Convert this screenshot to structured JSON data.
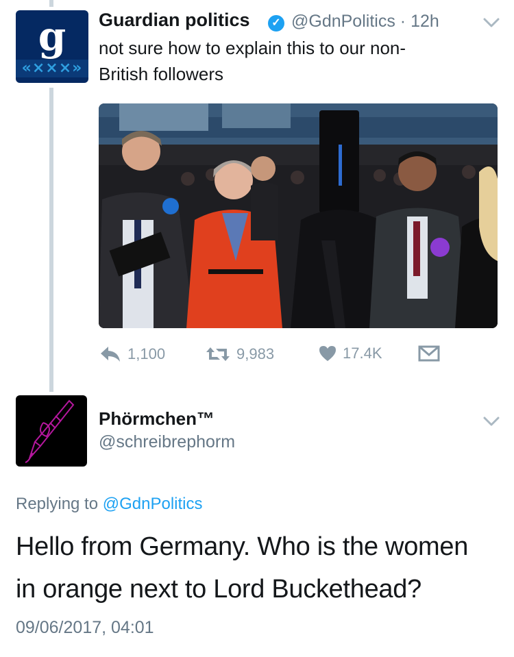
{
  "tweet": {
    "author_name": "Guardian politics",
    "author_handle": "@GdnPolitics",
    "separator": "·",
    "time": "12h",
    "avatar_letter": "g",
    "avatar_pattern": "«×××»",
    "text_line1": "not sure how to explain this to our non-",
    "text_line2": "British followers",
    "photo_alt": "photo",
    "actions": {
      "reply_count": "1,100",
      "retweet_count": "9,983",
      "like_count": "17.4K"
    }
  },
  "reply": {
    "author_name": "Phörmchen™",
    "author_handle": "@schreibrephorm",
    "replying_prefix": "Replying to",
    "replying_to": "@GdnPolitics",
    "text_line1": "Hello from Germany. Who is the women",
    "text_line2": "in orange next to Lord Buckethead?",
    "timestamp": "09/06/2017, 04:01"
  },
  "icons": {
    "verified": "verified-badge-icon",
    "chevron": "chevron-down-icon",
    "reply": "reply-icon",
    "retweet": "retweet-icon",
    "like": "heart-icon",
    "dm": "direct-message-icon"
  },
  "colors": {
    "accent": "#1da1f2",
    "muted": "#657786",
    "action": "#8899a6",
    "guardian_blue": "#052962",
    "thread_line": "#ccd6dd"
  }
}
